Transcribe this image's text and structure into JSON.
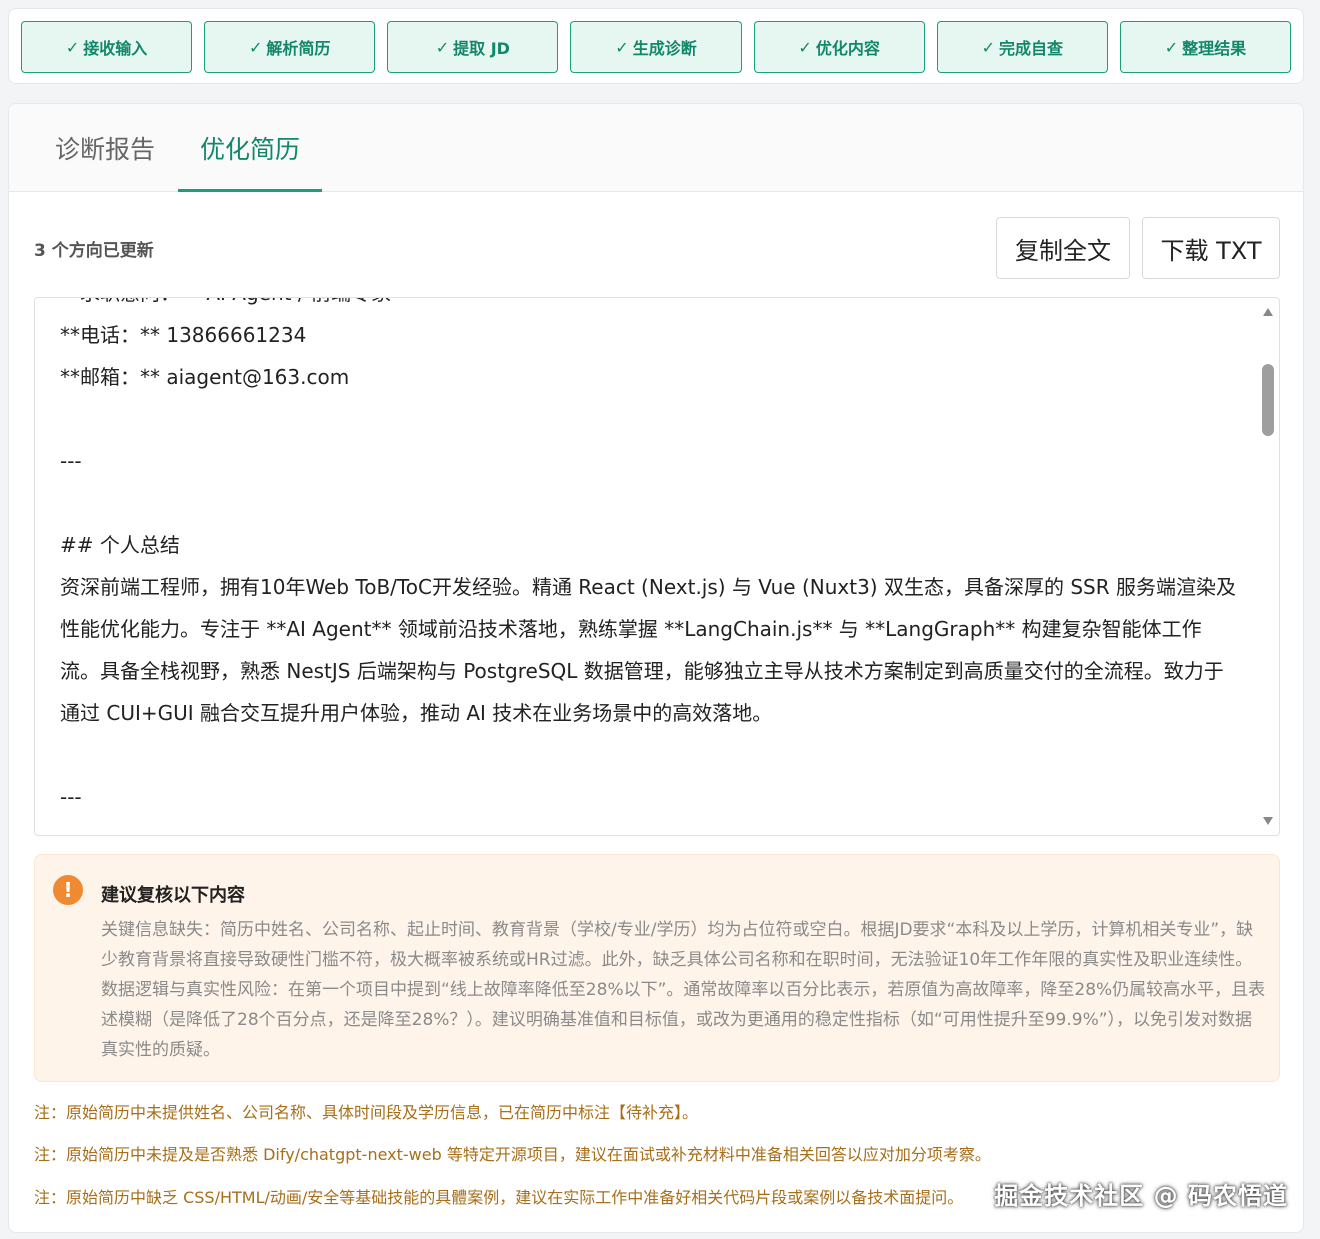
{
  "steps": [
    {
      "check": "✓",
      "label": "接收输入"
    },
    {
      "check": "✓",
      "label": "解析简历"
    },
    {
      "check": "✓",
      "label": "提取 JD"
    },
    {
      "check": "✓",
      "label": "生成诊断"
    },
    {
      "check": "✓",
      "label": "优化内容"
    },
    {
      "check": "✓",
      "label": "完成自查"
    },
    {
      "check": "✓",
      "label": "整理结果"
    }
  ],
  "tabs": {
    "diagnosis": "诊断报告",
    "optimized": "优化简历"
  },
  "toolbar": {
    "status": "3 个方向已更新",
    "copy_label": "复制全文",
    "download_label": "下载 TXT"
  },
  "editor": {
    "line_top": "**求职意向：** AI Agent / 前端专家",
    "line_phone": "**电话：** 13866661234",
    "line_email": "**邮箱：** aiagent@163.com",
    "divider1": "---",
    "heading_summary": "## 个人总结",
    "summary": "资深前端工程师，拥有10年Web ToB/ToC开发经验。精通 React (Next.js) 与 Vue (Nuxt3) 双生态，具备深厚的 SSR 服务端渲染及性能优化能力。专注于 **AI Agent** 领域前沿技术落地，熟练掌握 **LangChain.js** 与 **LangGraph** 构建复杂智能体工作流。具备全栈视野，熟悉 NestJS 后端架构与 PostgreSQL 数据管理，能够独立主导从技术方案制定到高质量交付的全流程。致力于通过 CUI+GUI 融合交互提升用户体验，推动 AI 技术在业务场景中的高效落地。",
    "divider2": "---"
  },
  "alert": {
    "icon": "!",
    "title": "建议复核以下内容",
    "body": "关键信息缺失：简历中姓名、公司名称、起止时间、教育背景（学校/专业/学历）均为占位符或空白。根据JD要求“本科及以上学历，计算机相关专业”，缺少教育背景将直接导致硬性门槛不符，极大概率被系统或HR过滤。此外，缺乏具体公司名称和在职时间，无法验证10年工作年限的真实性及职业连续性。 数据逻辑与真实性风险：在第一个项目中提到“线上故障率降低至28%以下”。通常故障率以百分比表示，若原值为高故障率，降至28%仍属较高水平，且表述模糊（是降低了28个百分点，还是降至28%？）。建议明确基准值和目标值，或改为更通用的稳定性指标（如“可用性提升至99.9%”），以免引发对数据真实性的质疑。"
  },
  "notes": [
    "注：原始简历中未提供姓名、公司名称、具体时间段及学历信息，已在简历中标注【待补充】。",
    "注：原始简历中未提及是否熟悉 Dify/chatgpt-next-web 等特定开源项目，建议在面试或补充材料中准备相关回答以应对加分项考察。",
    "注：原始简历中缺乏 CSS/HTML/动画/安全等基础技能的具體案例，建议在实际工作中准备好相关代码片段或案例以备技术面提问。"
  ],
  "watermark": "掘金技术社区 @ 码农悟道"
}
